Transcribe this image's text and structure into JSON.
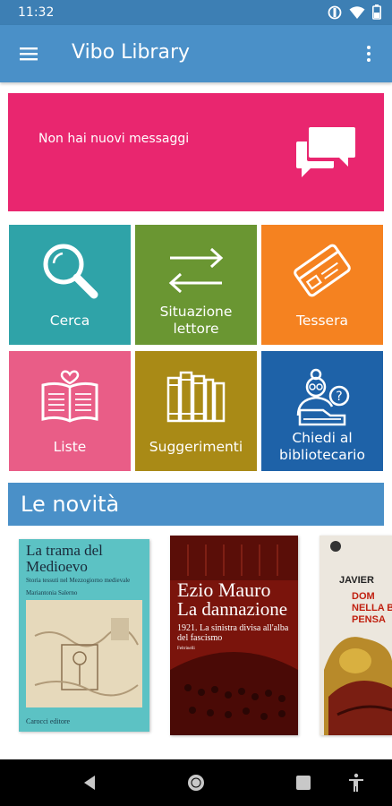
{
  "status_bar": {
    "time": "11:32",
    "icons": [
      "do-not-disturb-icon",
      "wifi-icon",
      "battery-icon"
    ]
  },
  "app_bar": {
    "title": "Vibo Library",
    "icons": [
      "menu-icon",
      "more-vert-icon"
    ]
  },
  "messages_card": {
    "text": "Non hai nuovi messaggi",
    "icon": "chat-bubbles-icon",
    "color": "#e9266f"
  },
  "tiles": [
    {
      "label": "Cerca",
      "icon": "search-icon",
      "color": "#2fa3a8"
    },
    {
      "label": "Situazione lettore",
      "icon": "swap-arrows-icon",
      "color": "#6a9632"
    },
    {
      "label": "Tessera",
      "icon": "card-icon",
      "color": "#f58220"
    },
    {
      "label": "Liste",
      "icon": "book-heart-icon",
      "color": "#e95d87"
    },
    {
      "label": "Suggerimenti",
      "icon": "bookshelf-icon",
      "color": "#a98a16"
    },
    {
      "label": "Chiedi al bibliotecario",
      "icon": "librarian-question-icon",
      "color": "#1e62a8"
    }
  ],
  "section": {
    "title": "Le novità"
  },
  "books": [
    {
      "title": "La trama del Medioevo",
      "subtitle": "Storia tessuti nel Mezzogiorno medievale",
      "author": "Mariantonia Salerno",
      "publisher": "Carocci editore"
    },
    {
      "author": "Ezio Mauro",
      "title": "La dannazione",
      "subtitle": "1921. La sinistra divisa all'alba del fascismo",
      "publisher": "Feltrinelli"
    },
    {
      "author": "JAVIER",
      "title": "DOM NELLA BA PENSA"
    }
  ],
  "nav_bar": {
    "icons": [
      "back-icon",
      "home-icon",
      "recents-icon",
      "accessibility-icon"
    ]
  },
  "colors": {
    "status_bar": "#3d7fb4",
    "app_bar": "#4a90c8",
    "nav_bar": "#000000"
  }
}
